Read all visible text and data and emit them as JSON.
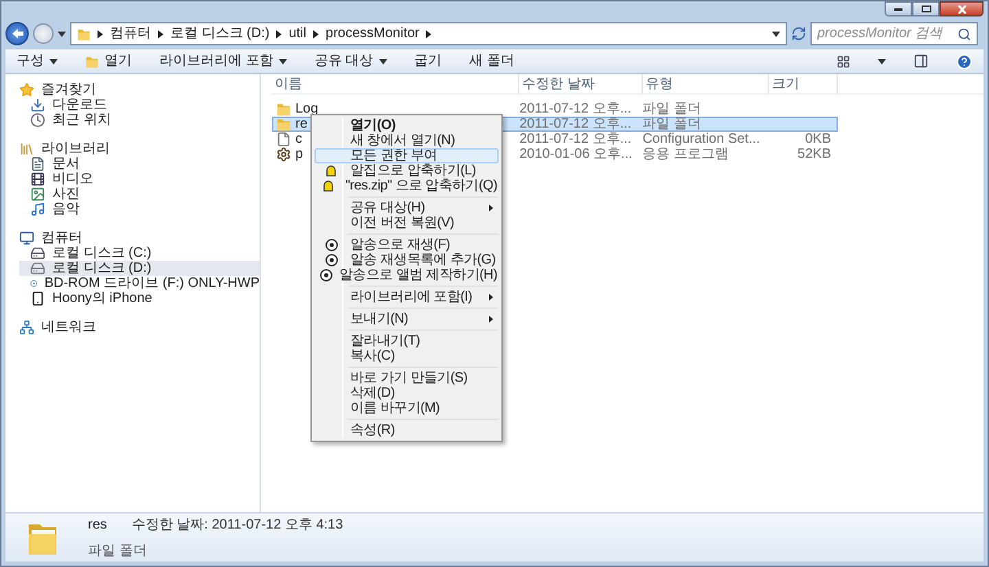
{
  "address": {
    "crumbs": [
      "컴퓨터",
      "로컬 디스크 (D:)",
      "util",
      "processMonitor"
    ]
  },
  "search": {
    "placeholder": "processMonitor 검색"
  },
  "toolbar": [
    {
      "label": "구성",
      "dropdown": true,
      "kind": "plain"
    },
    {
      "label": "열기",
      "dropdown": false,
      "kind": "open"
    },
    {
      "label": "라이브러리에 포함",
      "dropdown": true,
      "kind": "plain"
    },
    {
      "label": "공유 대상",
      "dropdown": true,
      "kind": "plain"
    },
    {
      "label": "굽기",
      "dropdown": false,
      "kind": "plain"
    },
    {
      "label": "새 폴더",
      "dropdown": false,
      "kind": "plain"
    }
  ],
  "sidebar": {
    "sections": [
      {
        "label": "즐겨찾기",
        "children": [
          {
            "label": "다운로드",
            "selected": false
          },
          {
            "label": "최근 위치",
            "selected": false
          }
        ]
      },
      {
        "label": "라이브러리",
        "children": [
          {
            "label": "문서",
            "selected": false
          },
          {
            "label": "비디오",
            "selected": false
          },
          {
            "label": "사진",
            "selected": false
          },
          {
            "label": "음악",
            "selected": false
          }
        ]
      },
      {
        "label": "컴퓨터",
        "children": [
          {
            "label": "로컬 디스크 (C:)",
            "selected": false
          },
          {
            "label": "로컬 디스크 (D:)",
            "selected": true
          },
          {
            "label": "BD-ROM 드라이브 (F:) ONLY-HWP",
            "selected": false
          },
          {
            "label": "Hoony의 iPhone",
            "selected": false
          }
        ]
      },
      {
        "label": "네트워크"
      }
    ]
  },
  "table": {
    "columns": [
      "이름",
      "수정한 날짜",
      "유형",
      "크기"
    ],
    "rows": [
      {
        "kind": "folder",
        "name": "Log",
        "modified": "2011-07-12 오후...",
        "type": "파일 폴더",
        "selected": false
      },
      {
        "kind": "folder",
        "name": "re",
        "modified": "2011-07-12 오후...",
        "type": "파일 폴더",
        "selected": true
      },
      {
        "kind": "file",
        "name": "c",
        "modified": "2011-07-12 오후...",
        "type": "Configuration Set...",
        "size": "0KB",
        "selected": false
      },
      {
        "kind": "app",
        "name": "p",
        "modified": "2010-01-06 오후...",
        "type": "응용 프로그램",
        "size": "52KB",
        "selected": false
      }
    ]
  },
  "context_menu": {
    "groups": [
      [
        {
          "kind": "item",
          "label": "열기(O)",
          "default": true,
          "highlighted": false,
          "submenu": false
        },
        {
          "kind": "item",
          "label": "새 창에서 열기(N)",
          "default": false,
          "highlighted": false,
          "submenu": false
        },
        {
          "kind": "item",
          "label": "모든 권한 부여",
          "default": false,
          "highlighted": true,
          "submenu": false
        },
        {
          "kind": "zip",
          "label": "알집으로 압축하기(L)",
          "default": false,
          "highlighted": false,
          "submenu": false
        },
        {
          "kind": "zip",
          "label": "\"res.zip\" 으로 압축하기(Q)",
          "default": false,
          "highlighted": false,
          "submenu": false
        }
      ],
      [
        {
          "kind": "item",
          "label": "공유 대상(H)",
          "default": false,
          "highlighted": false,
          "submenu": true
        },
        {
          "kind": "item",
          "label": "이전 버전 복원(V)",
          "default": false,
          "highlighted": false,
          "submenu": false
        }
      ],
      [
        {
          "kind": "player",
          "label": "알송으로 재생(F)",
          "default": false,
          "highlighted": false,
          "submenu": false
        },
        {
          "kind": "player",
          "label": "알송 재생목록에 추가(G)",
          "default": false,
          "highlighted": false,
          "submenu": false
        },
        {
          "kind": "player",
          "label": "알송으로 앨범 제작하기(H)",
          "default": false,
          "highlighted": false,
          "submenu": false
        }
      ],
      [
        {
          "kind": "item",
          "label": "라이브러리에 포함(I)",
          "default": false,
          "highlighted": false,
          "submenu": true
        }
      ],
      [
        {
          "kind": "item",
          "label": "보내기(N)",
          "default": false,
          "highlighted": false,
          "submenu": true
        }
      ],
      [
        {
          "kind": "item",
          "label": "잘라내기(T)",
          "default": false,
          "highlighted": false,
          "submenu": false
        },
        {
          "kind": "item",
          "label": "복사(C)",
          "default": false,
          "highlighted": false,
          "submenu": false
        }
      ],
      [
        {
          "kind": "item",
          "label": "바로 가기 만들기(S)",
          "default": false,
          "highlighted": false,
          "submenu": false
        },
        {
          "kind": "item",
          "label": "삭제(D)",
          "default": false,
          "highlighted": false,
          "submenu": false
        },
        {
          "kind": "item",
          "label": "이름 바꾸기(M)",
          "default": false,
          "highlighted": false,
          "submenu": false
        }
      ],
      [
        {
          "kind": "item",
          "label": "속성(R)",
          "default": false,
          "highlighted": false,
          "submenu": false
        }
      ]
    ]
  },
  "details": {
    "name": "res",
    "modified": "수정한 날짜: 2011-07-12 오후 4:13",
    "type": "파일 폴더"
  }
}
